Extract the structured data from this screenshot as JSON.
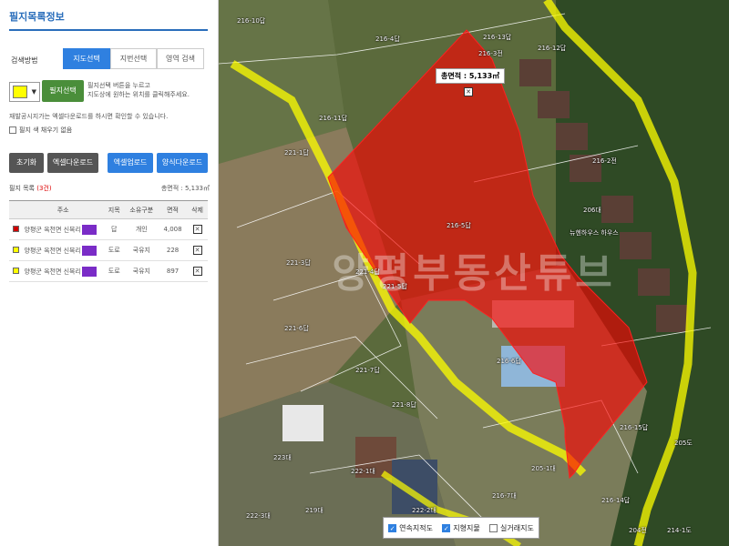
{
  "panel": {
    "title": "필지목록정보",
    "search_label": "검색방법",
    "tabs": [
      {
        "label": "지도선택",
        "active": true
      },
      {
        "label": "지번선택",
        "active": false
      },
      {
        "label": "영역 검색",
        "active": false
      }
    ],
    "color": "#ffff00",
    "select_button": "필지선택",
    "help_line1": "필지선택 버튼을 누르고",
    "help_line2": "지도상에 원하는 위치를 클릭해주세요.",
    "notice": "재발공시지가는 엑셀다운로드를 하시면 확인할 수 있습니다.",
    "fill_checkbox_label": "필지 색 채우기 없음",
    "buttons": {
      "reset": "초기화",
      "excel_download": "엑셀다운로드",
      "excel_upload": "엑셀업로드",
      "form_download": "양식다운로드"
    },
    "list_title": "필지 목록",
    "list_count": "(3건)",
    "total_area": "총면적 : 5,133㎡",
    "table": {
      "headers": [
        "",
        "주소",
        "지목",
        "소유구분",
        "면적",
        "삭제"
      ],
      "rows": [
        {
          "color": "#d00000",
          "address": "양평군 옥천면 신복리",
          "jimok": "답",
          "owner": "개인",
          "area": "4,008"
        },
        {
          "color": "#ffff00",
          "address": "양평군 옥천면 신복리",
          "jimok": "도로",
          "owner": "국유지",
          "area": "228"
        },
        {
          "color": "#ffff00",
          "address": "양평군 옥천면 신복리",
          "jimok": "도로",
          "owner": "국유지",
          "area": "897"
        }
      ]
    }
  },
  "map": {
    "area_label": "총면적 : 5,133㎡",
    "close_icon": "✕",
    "watermark": "양평부동산튜브",
    "labels": [
      "216-10답",
      "216-4답",
      "216-13답",
      "216-11답",
      "216-12답",
      "216-3전",
      "216-2전",
      "216-5답",
      "216-6답",
      "216-7대",
      "216-14답",
      "206대",
      "221-1답",
      "221-3답",
      "221-4답",
      "221-5답",
      "221-6답",
      "221-7답",
      "221-8답",
      "222-1대",
      "222-2대",
      "223대",
      "219대",
      "222-3대",
      "216-15답",
      "205-1대",
      "205도",
      "204전",
      "214-1도",
      "뉴헨하우스 하우스"
    ],
    "layers": [
      {
        "label": "연속지적도",
        "checked": true
      },
      {
        "label": "지형지물",
        "checked": true
      },
      {
        "label": "실거래지도",
        "checked": false
      }
    ],
    "colors": {
      "parcel_fill": "#ff0000",
      "road_fill": "#ffff00"
    }
  }
}
